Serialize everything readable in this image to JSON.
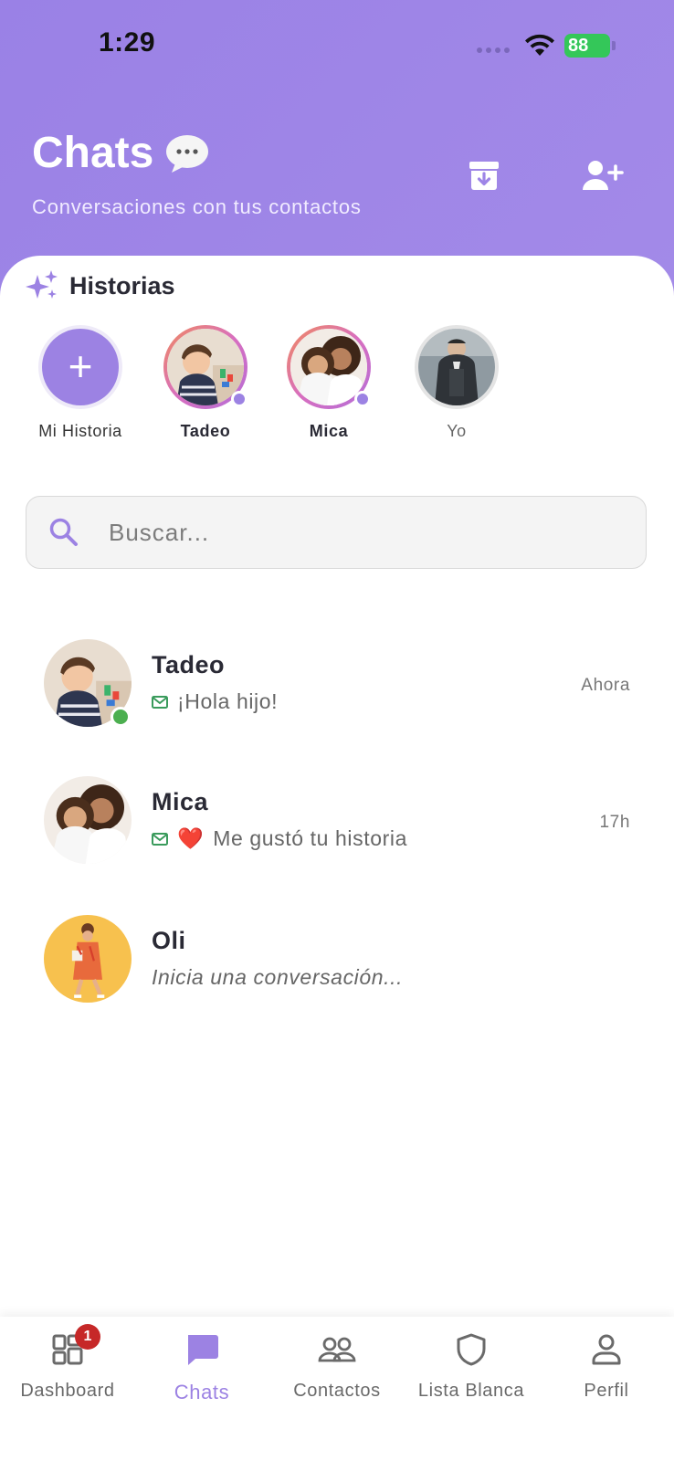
{
  "status_bar": {
    "time": "1:29",
    "battery": "88"
  },
  "header": {
    "title": "Chats",
    "subtitle": "Conversaciones con tus contactos",
    "icons": [
      "chat-bubble-icon",
      "archive-icon",
      "add-user-icon"
    ]
  },
  "stories": {
    "title": "Historias",
    "items": [
      {
        "label": "Mi Historia",
        "type": "add"
      },
      {
        "label": "Tadeo",
        "type": "unseen"
      },
      {
        "label": "Mica",
        "type": "unseen"
      },
      {
        "label": "Yo",
        "type": "seen"
      }
    ]
  },
  "search": {
    "placeholder": "Buscar..."
  },
  "chats": [
    {
      "name": "Tadeo",
      "preview": "¡Hola hijo!",
      "time": "Ahora",
      "online": true
    },
    {
      "name": "Mica",
      "preview": "Me gustó tu historia",
      "time": "17h",
      "emoji": "❤️"
    },
    {
      "name": "Oli",
      "preview": "Inicia una conversación..."
    }
  ],
  "bottom_nav": {
    "items": [
      {
        "label": "Dashboard",
        "badge": "1"
      },
      {
        "label": "Chats",
        "active": true
      },
      {
        "label": "Contactos"
      },
      {
        "label": "Lista Blanca"
      },
      {
        "label": "Perfil"
      }
    ]
  },
  "colors": {
    "accent": "#9c82e3",
    "header_bg": "#9e85e7",
    "online": "#4caf50",
    "badge": "#c62828",
    "mail": "#3a9b5c"
  }
}
